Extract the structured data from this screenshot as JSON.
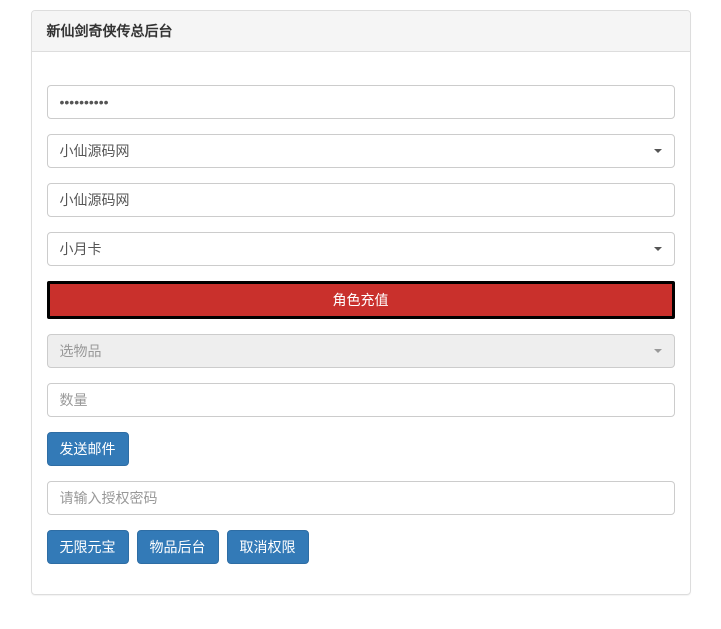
{
  "panel": {
    "title": "新仙剑奇侠传总后台"
  },
  "form": {
    "password_value": "••••••••••",
    "server_select": "小仙源码网",
    "name_value": "小仙源码网",
    "card_select": "小月卡",
    "recharge_button": "角色充值",
    "item_select_placeholder": "选物品",
    "quantity_placeholder": "数量",
    "send_mail_button": "发送邮件",
    "auth_password_placeholder": "请输入授权密码",
    "unlimited_gold_button": "无限元宝",
    "item_backend_button": "物品后台",
    "cancel_permission_button": "取消权限"
  }
}
